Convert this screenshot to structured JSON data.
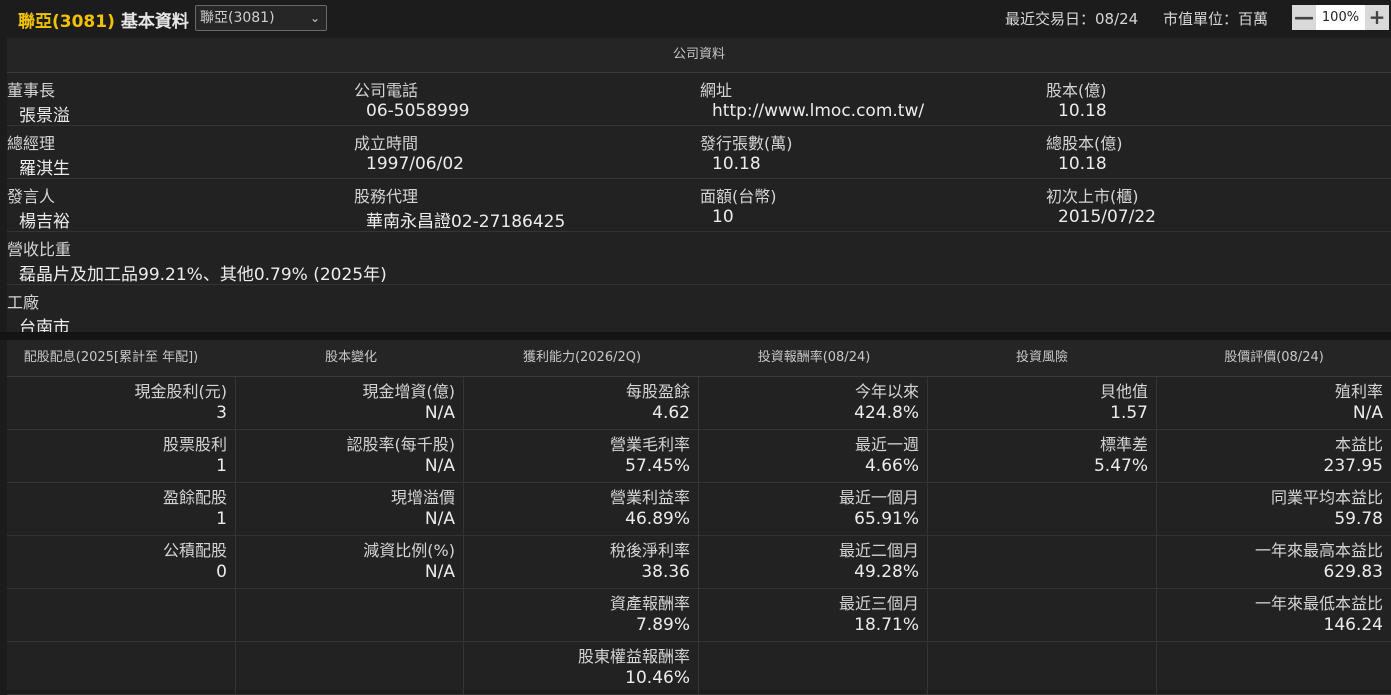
{
  "header": {
    "stock_name": "聯亞(3081)",
    "page_title": "基本資料",
    "stock_select_value": "聯亞(3081)",
    "last_trade_date": "最近交易日：08/24",
    "market_value_unit": "市值單位：百萬",
    "zoom_value": "100%",
    "zoom_out_label": "—",
    "zoom_in_label": "+"
  },
  "company": {
    "section_title": "公司資料",
    "rows": [
      [
        {
          "label": "董事長",
          "value": "張景溢"
        },
        {
          "label": "公司電話",
          "value": "06-5058999"
        },
        {
          "label": "網址",
          "value": "http://www.lmoc.com.tw/"
        },
        {
          "label": "股本(億)",
          "value": "10.18"
        }
      ],
      [
        {
          "label": "總經理",
          "value": "羅淇生"
        },
        {
          "label": "成立時間",
          "value": "1997/06/02"
        },
        {
          "label": "發行張數(萬)",
          "value": "10.18"
        },
        {
          "label": "總股本(億)",
          "value": "10.18"
        }
      ],
      [
        {
          "label": "發言人",
          "value": "楊吉裕"
        },
        {
          "label": "股務代理",
          "value": "華南永昌證02-27186425"
        },
        {
          "label": "面額(台幣)",
          "value": "10"
        },
        {
          "label": "初次上市(櫃)",
          "value": "2015/07/22"
        }
      ]
    ],
    "revenue_mix": {
      "label": "營收比重",
      "value": "磊晶片及加工品99.21%、其他0.79% (2025年)"
    },
    "factory": {
      "label": "工廠",
      "value": "台南市"
    }
  },
  "financials": {
    "headers": [
      "配股配息(2025[累計至 年配])",
      "股本變化",
      "獲利能力(2026/2Q)",
      "投資報酬率(08/24)",
      "投資風險",
      "股價評價(08/24)"
    ],
    "rows": [
      [
        {
          "label": "現金股利(元)",
          "value": "3"
        },
        {
          "label": "現金增資(億)",
          "value": "N/A"
        },
        {
          "label": "每股盈餘",
          "value": "4.62"
        },
        {
          "label": "今年以來",
          "value": "424.8%"
        },
        {
          "label": "貝他值",
          "value": "1.57"
        },
        {
          "label": "殖利率",
          "value": "N/A"
        }
      ],
      [
        {
          "label": "股票股利",
          "value": "1"
        },
        {
          "label": "認股率(每千股)",
          "value": "N/A"
        },
        {
          "label": "營業毛利率",
          "value": "57.45%"
        },
        {
          "label": "最近一週",
          "value": "4.66%"
        },
        {
          "label": "標準差",
          "value": "5.47%"
        },
        {
          "label": "本益比",
          "value": "237.95"
        }
      ],
      [
        {
          "label": "盈餘配股",
          "value": "1"
        },
        {
          "label": "現增溢價",
          "value": "N/A"
        },
        {
          "label": "營業利益率",
          "value": "46.89%"
        },
        {
          "label": "最近一個月",
          "value": "65.91%"
        },
        {
          "label": "",
          "value": ""
        },
        {
          "label": "同業平均本益比",
          "value": "59.78"
        }
      ],
      [
        {
          "label": "公積配股",
          "value": "0"
        },
        {
          "label": "減資比例(%)",
          "value": "N/A"
        },
        {
          "label": "稅後淨利率",
          "value": "38.36"
        },
        {
          "label": "最近二個月",
          "value": "49.28%"
        },
        {
          "label": "",
          "value": ""
        },
        {
          "label": "一年來最高本益比",
          "value": "629.83"
        }
      ],
      [
        {
          "label": "",
          "value": ""
        },
        {
          "label": "",
          "value": ""
        },
        {
          "label": "資產報酬率",
          "value": "7.89%"
        },
        {
          "label": "最近三個月",
          "value": "18.71%"
        },
        {
          "label": "",
          "value": ""
        },
        {
          "label": "一年來最低本益比",
          "value": "146.24"
        }
      ],
      [
        {
          "label": "",
          "value": ""
        },
        {
          "label": "",
          "value": ""
        },
        {
          "label": "股東權益報酬率",
          "value": "10.46%"
        },
        {
          "label": "",
          "value": ""
        },
        {
          "label": "",
          "value": ""
        },
        {
          "label": "",
          "value": ""
        }
      ]
    ]
  }
}
